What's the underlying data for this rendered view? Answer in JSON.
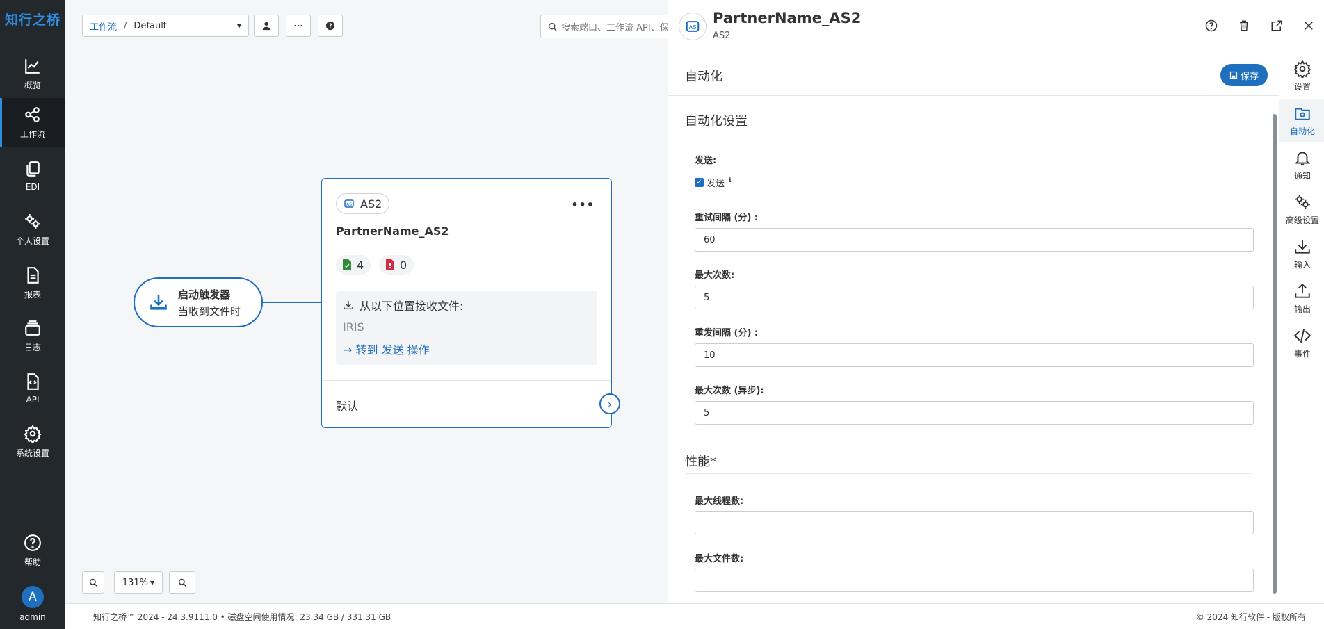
{
  "brand": "知行之桥",
  "nav": {
    "items": [
      {
        "label": "概览",
        "icon": "chart-line-icon"
      },
      {
        "label": "工作流",
        "icon": "workflow-icon"
      },
      {
        "label": "EDI",
        "icon": "documents-icon"
      },
      {
        "label": "个人设置",
        "icon": "gears-icon"
      },
      {
        "label": "报表",
        "icon": "report-icon"
      },
      {
        "label": "日志",
        "icon": "log-icon"
      },
      {
        "label": "API",
        "icon": "api-icon"
      },
      {
        "label": "系统设置",
        "icon": "gear-icon"
      }
    ],
    "help_label": "帮助",
    "user_initial": "A",
    "user_name": "admin",
    "active_item": "工作流"
  },
  "toolbar": {
    "breadcrumb_root": "工作流",
    "breadcrumb_sep": "/",
    "breadcrumb_current": "Default",
    "search_placeholder": "搜索端口、工作流 API、保"
  },
  "canvas": {
    "trigger_title": "启动触发器",
    "trigger_subtitle": "当收到文件时",
    "card": {
      "type_label": "AS2",
      "name": "PartnerName_AS2",
      "success_count": "4",
      "error_count": "0",
      "receive_label": "从以下位置接收文件:",
      "receive_source": "IRIS",
      "goto_label": "→ 转到 发送 操作",
      "footer_label": "默认"
    },
    "zoom_level": "131%"
  },
  "status": {
    "left": "知行之桥™ 2024 - 24.3.9111.0  •  磁盘空间使用情况:  23.34 GB / 331.31 GB",
    "right": "© 2024 知行软件 - 版权所有"
  },
  "panel": {
    "title": "PartnerName_AS2",
    "subtitle": "AS2",
    "section_header": "自动化",
    "save_label": "保存",
    "automation": {
      "heading": "自动化设置",
      "send_label": "发送:",
      "send_checkbox_label": "发送",
      "retry_interval_label": "重试间隔 (分) :",
      "retry_interval_value": "60",
      "max_attempts_label": "最大次数:",
      "max_attempts_value": "5",
      "resend_interval_label": "重发间隔 (分) :",
      "resend_interval_value": "10",
      "max_attempts_async_label": "最大次数 (异步):",
      "max_attempts_async_value": "5"
    },
    "performance": {
      "heading": "性能*",
      "max_threads_label": "最大线程数:",
      "max_threads_value": "",
      "max_files_label": "最大文件数:",
      "max_files_value": ""
    },
    "tabs": [
      {
        "label": "设置",
        "icon": "settings-icon"
      },
      {
        "label": "自动化",
        "icon": "automation-folder-icon"
      },
      {
        "label": "通知",
        "icon": "bell-icon"
      },
      {
        "label": "高级设置",
        "icon": "advanced-gears-icon"
      },
      {
        "label": "输入",
        "icon": "input-download-icon"
      },
      {
        "label": "输出",
        "icon": "output-upload-icon"
      },
      {
        "label": "事件",
        "icon": "code-icon"
      }
    ]
  },
  "colors": {
    "accent": "#1f6fbf",
    "nav_bg": "#23282d",
    "success": "#2e8b3a",
    "error": "#d6293e"
  }
}
